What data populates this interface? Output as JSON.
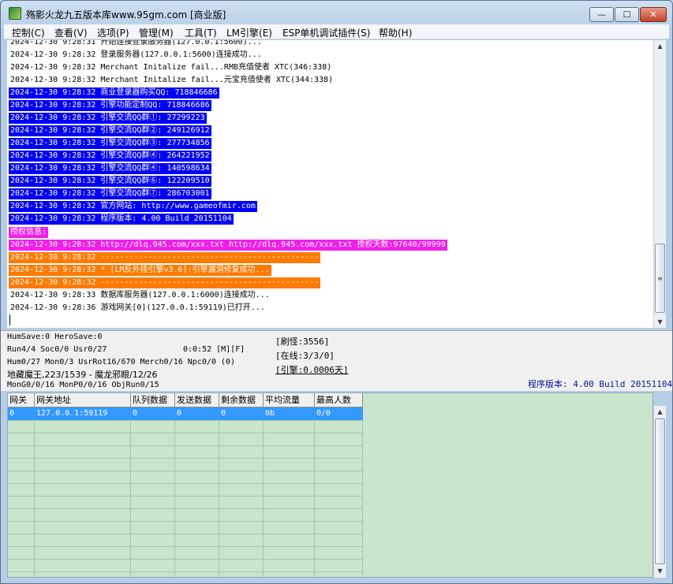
{
  "window": {
    "title": "殇影火龙九五版本库www.95gm.com [商业版]",
    "minimize": "—",
    "maximize": "☐",
    "close": "✕"
  },
  "menu": [
    "控制(C)",
    "查看(V)",
    "选项(P)",
    "管理(M)",
    "工具(T)",
    "LM引擎(E)",
    "ESP单机调试插件(S)",
    "帮助(H)"
  ],
  "log": [
    {
      "text": "2024-12-30 9:28:31 开始连接登录服务器(127.0.0.1:5600)...",
      "style": "wh"
    },
    {
      "text": "2024-12-30 9:28:32 登录服务器(127.0.0.1:5600)连接成功...",
      "style": "wh"
    },
    {
      "text": "2024-12-30 9:28:32 Merchant Initalize fail...RMB充值使者 XTC(346:338)",
      "style": "wh"
    },
    {
      "text": "2024-12-30 9:28:32 Merchant Initalize fail...元宝充值使者 XTC(344:338)",
      "style": "wh"
    },
    {
      "text": "2024-12-30 9:28:32 商业登录器购买QQ: 718846686",
      "style": "bl"
    },
    {
      "text": "2024-12-30 9:28:32 引擎功能定制QQ: 718846686",
      "style": "bl"
    },
    {
      "text": "2024-12-30 9:28:32 引擎交流QQ群①: 27299223",
      "style": "bl"
    },
    {
      "text": "2024-12-30 9:28:32 引擎交流QQ群②: 249126912",
      "style": "bl"
    },
    {
      "text": "2024-12-30 9:28:32 引擎交流QQ群③: 277734856",
      "style": "bl"
    },
    {
      "text": "2024-12-30 9:28:32 引擎交流QQ群④: 264221952",
      "style": "bl"
    },
    {
      "text": "2024-12-30 9:28:32 引擎交流QQ群④: 140598634",
      "style": "bl"
    },
    {
      "text": "2024-12-30 9:28:32 引擎交流QQ群⑥: 122209510",
      "style": "bl"
    },
    {
      "text": "2024-12-30 9:28:32 引擎交流QQ群⑦: 286703001",
      "style": "bl"
    },
    {
      "text": "2024-12-30 9:28:32 官方网站: http://www.gameofmir.com",
      "style": "bl"
    },
    {
      "text": "2024-12-30 9:28:32 程序版本: 4.00 Build 20151104",
      "style": "bl"
    },
    {
      "text": "授权信息:",
      "style": "mg"
    },
    {
      "text": "2024-12-30 9:28:32 http://dlq.945.com/xxx.txt http://dlq.945.com/xxx.txt 授权天数:97640/99999",
      "style": "mg"
    },
    {
      "text": "2024-12-30 9:28:32 ----------------------------------------------",
      "style": "or"
    },
    {
      "text": "2024-12-30 9:28:32 * [LM反外挂引擎v3.6]:引擎漏洞修复成功...",
      "style": "or"
    },
    {
      "text": "2024-12-30 9:28:32 ----------------------------------------------",
      "style": "or"
    },
    {
      "text": "2024-12-30 9:28:33 数据库服务器(127.0.0.1:6000)连接成功...",
      "style": "wh"
    },
    {
      "text": "2024-12-30 9:28:36 游戏网关[0](127.0.0.1:59119)已打开...",
      "style": "wh"
    }
  ],
  "status": {
    "line1": "HumSave:0 HeroSave:0",
    "line2": "Run4/4 Soc0/0 Usr0/27",
    "timer": "0:0:52 [M][F]",
    "line3": "Hum0/27 Mon0/3 UsrRot16/670 Merch0/16 Npc0/0 (0)",
    "line4": "地藏魔王,223/1539 - 魔龙邪眼/12/26",
    "line5": "MonG0/0/16 MonP0/0/16 ObjRun0/15",
    "refresh": "[刷怪:3556]",
    "online": "[在线:3/3/0]",
    "engine": "[引擎:0.0006天]",
    "version": "程序版本: 4.00 Build 20151104"
  },
  "grid": {
    "columns": [
      "网关",
      "网关地址",
      "队列数据",
      "发送数据",
      "剩余数据",
      "平均流量",
      "最高人数"
    ],
    "rows": [
      [
        "0",
        "127.0.0.1:59119",
        "0",
        "0",
        "0",
        "0b",
        "0/0"
      ]
    ]
  },
  "colors": {
    "log_blue": "#0000f5",
    "log_magenta": "#f020ea",
    "log_orange": "#ff7a00",
    "grid_bg": "#c9e6cd",
    "selected_row": "#3399ff"
  }
}
